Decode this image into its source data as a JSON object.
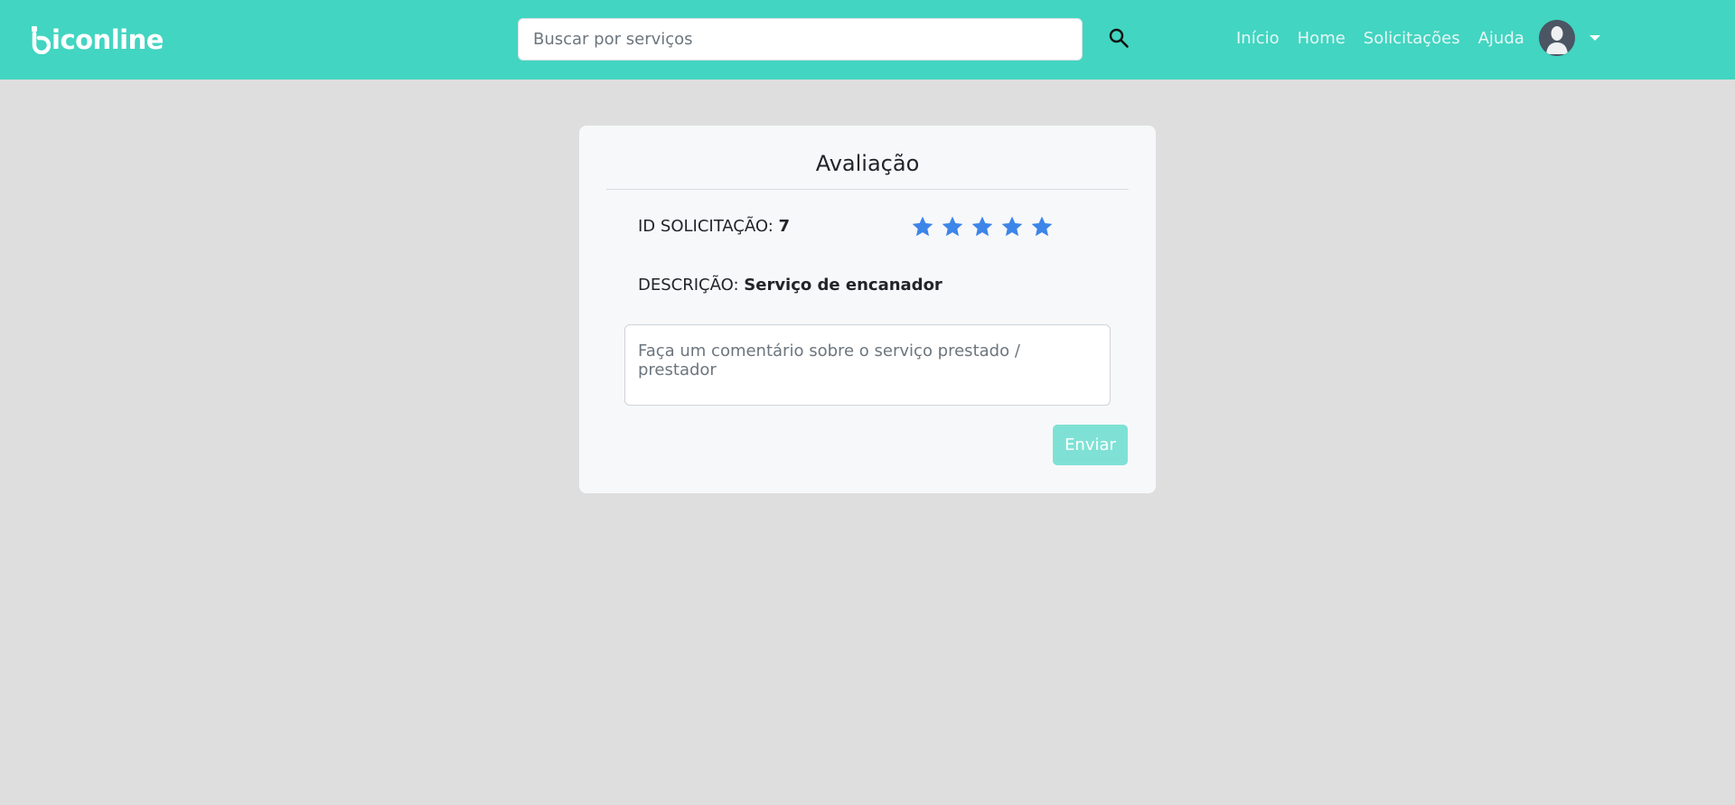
{
  "header": {
    "logo_text": "iconline",
    "logo_mark_icon": "stylized-b-logo-mark",
    "brand_color": "#42d5c1",
    "search": {
      "placeholder": "Buscar por serviços",
      "value": "",
      "icon": "search-icon"
    },
    "nav": {
      "items": [
        {
          "label": "Início"
        },
        {
          "label": "Home"
        },
        {
          "label": "Solicitações"
        },
        {
          "label": "Ajuda"
        }
      ]
    },
    "avatar_icon": "user-avatar-icon",
    "dropdown_icon": "caret-down-icon"
  },
  "rating_card": {
    "title": "Avaliação",
    "id_label": "ID SOLICITAÇÃO:",
    "id_value": "7",
    "description_label": "DESCRIÇÃO:",
    "description_value": "Serviço de encanador",
    "rating": {
      "value": 5,
      "max": 5,
      "star_icon": "star-icon",
      "star_color": "#3d85e9"
    },
    "comment": {
      "placeholder": "Faça um comentário sobre o serviço prestado / prestador",
      "value": ""
    },
    "submit_label": "Enviar",
    "submit_color": "#7fe1d5"
  }
}
